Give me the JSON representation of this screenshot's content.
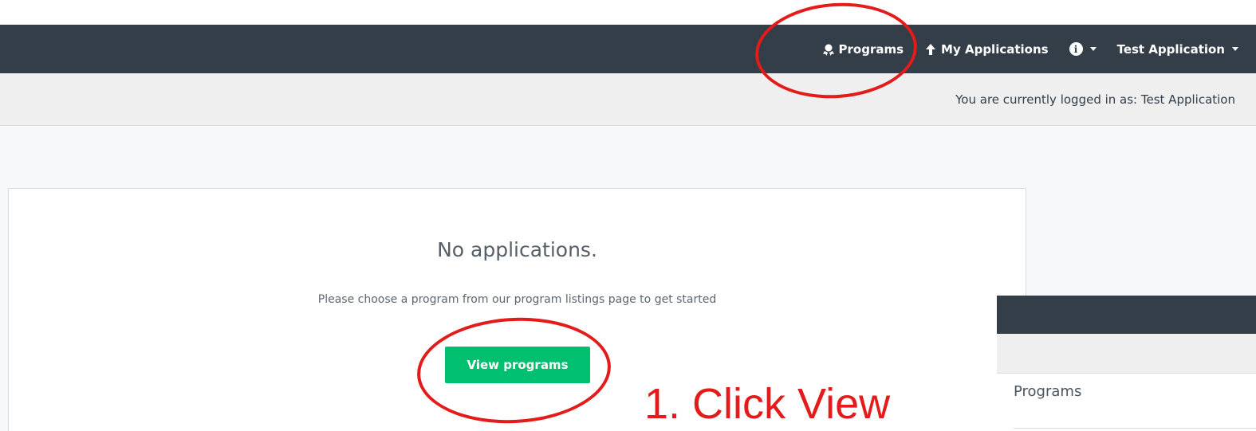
{
  "navbar": {
    "programs_label": "Programs",
    "my_applications_label": "My Applications",
    "user_menu_label": "Test Application",
    "info_glyph": "i"
  },
  "subbar": {
    "login_text": "You are currently logged in as: Test Application"
  },
  "empty_state": {
    "title": "No applications.",
    "subtitle": "Please choose a program from our program listings page to get started",
    "button_label": "View programs"
  },
  "overlay_panel": {
    "item_label": "Programs"
  },
  "annotation": {
    "text": "1. Click View"
  },
  "colors": {
    "navbar": "#333e48",
    "primary_button": "#00bf6f",
    "annotation": "#e31b1b"
  },
  "icons": [
    "award-icon",
    "upload-icon",
    "info-icon",
    "caret-down-icon"
  ]
}
